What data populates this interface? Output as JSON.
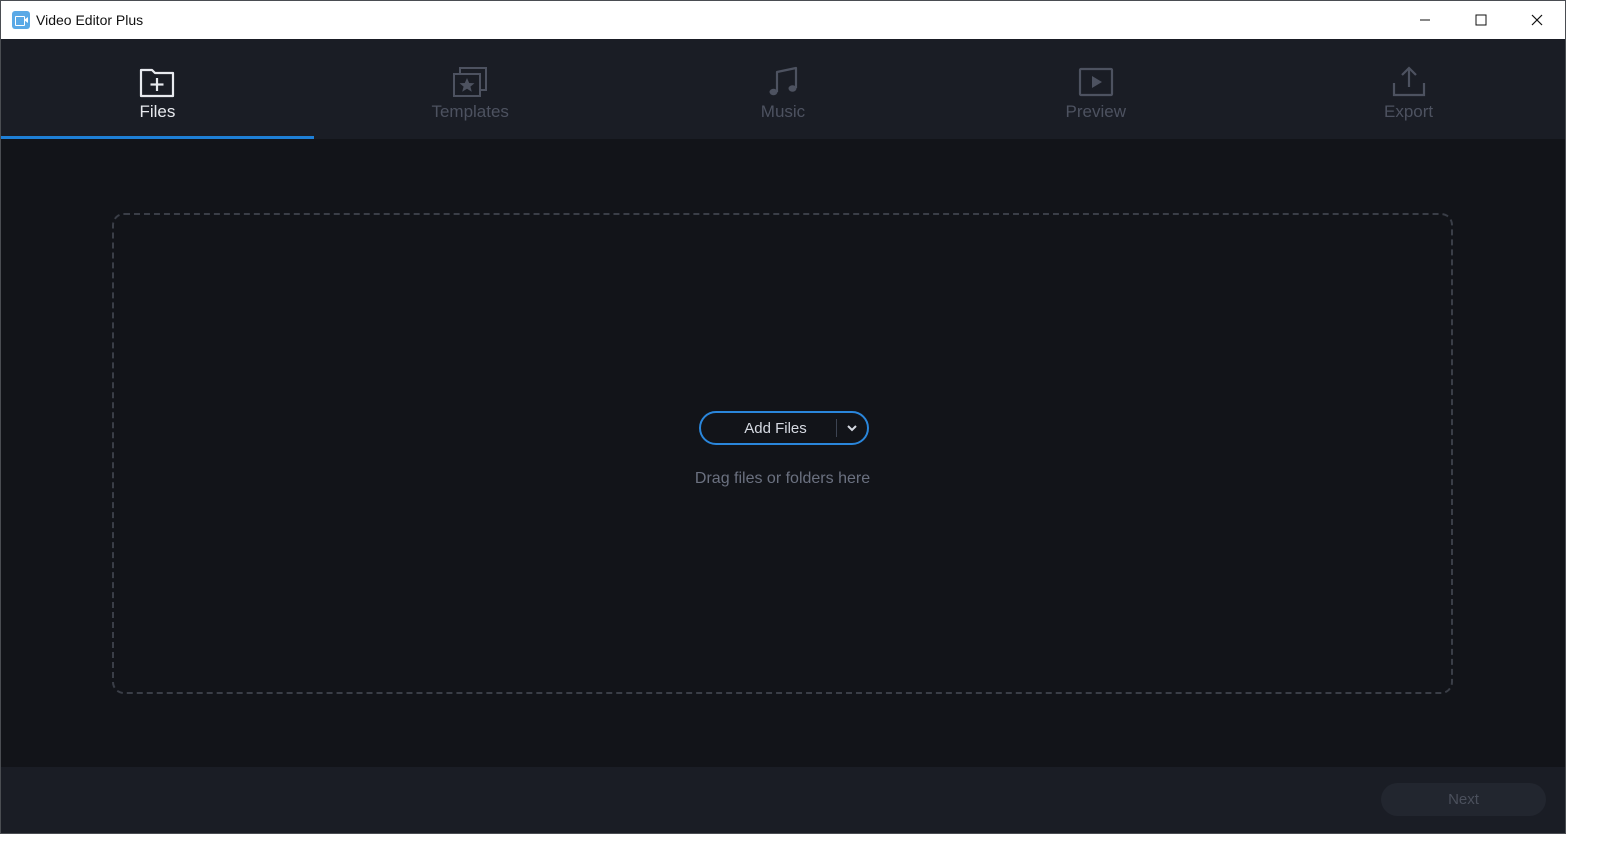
{
  "window": {
    "title": "Video Editor Plus"
  },
  "tabs": [
    {
      "label": "Files",
      "icon": "folder-plus-icon",
      "active": true
    },
    {
      "label": "Templates",
      "icon": "templates-star-icon",
      "active": false
    },
    {
      "label": "Music",
      "icon": "music-note-icon",
      "active": false
    },
    {
      "label": "Preview",
      "icon": "play-preview-icon",
      "active": false
    },
    {
      "label": "Export",
      "icon": "export-upload-icon",
      "active": false
    }
  ],
  "dropzone": {
    "add_files_label": "Add Files",
    "hint": "Drag files or folders here"
  },
  "footer": {
    "next_label": "Next"
  },
  "colors": {
    "accent": "#1e7fd6",
    "background": "#121419",
    "panel": "#1a1d25"
  }
}
